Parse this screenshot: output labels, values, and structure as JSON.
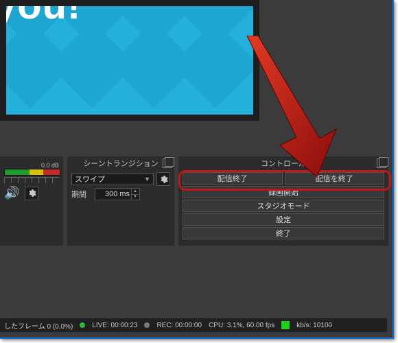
{
  "preview": {
    "text": "Thank you!"
  },
  "mixer": {
    "db_label": "0.0 dB"
  },
  "transitions": {
    "title": "シーントランジション",
    "selected": "スワイプ",
    "duration_label": "期間",
    "duration_value": "300 ms"
  },
  "controls": {
    "title": "コントロール",
    "stop_stream": "配信終了",
    "end_stream": "配信を終了",
    "start_record": "録画開始",
    "studio_mode": "スタジオモード",
    "settings": "設定",
    "exit": "終了"
  },
  "status": {
    "dropped": "したフレーム 0 (0.0%)",
    "live": "LIVE: 00:00:23",
    "rec": "REC: 00:00:00",
    "cpu": "CPU: 3.1%, 60.00 fps",
    "kbps": "kb/s: 10100"
  }
}
